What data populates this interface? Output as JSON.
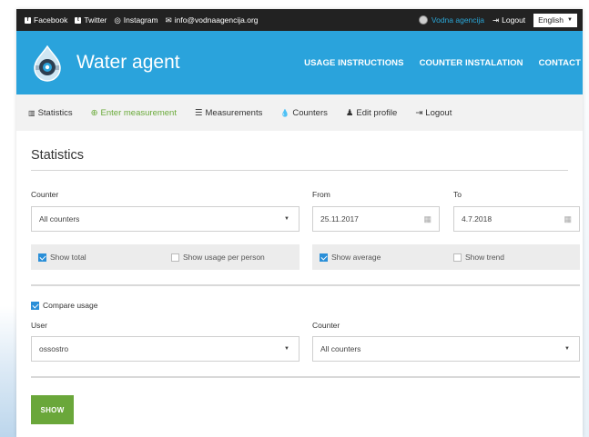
{
  "topbar": {
    "facebook": "Facebook",
    "twitter": "Twitter",
    "instagram": "Instagram",
    "email": "info@vodnaagencija.org",
    "agency": "Vodna agencija",
    "logout": "Logout",
    "language": "English"
  },
  "header": {
    "brand": "Water agent",
    "nav": [
      "USAGE INSTRUCTIONS",
      "COUNTER INSTALATION",
      "CONTACT"
    ]
  },
  "subnav": {
    "statistics": "Statistics",
    "enter": "Enter measurement",
    "measurements": "Measurements",
    "counters": "Counters",
    "edit": "Edit profile",
    "logout": "Logout"
  },
  "page": {
    "title": "Statistics",
    "counter_label": "Counter",
    "counter_value": "All counters",
    "from_label": "From",
    "from_value": "25.11.2017",
    "to_label": "To",
    "to_value": "4.7.2018",
    "show_total": "Show total",
    "show_per_person": "Show usage per person",
    "show_average": "Show average",
    "show_trend": "Show trend",
    "compare": "Compare usage",
    "user_label": "User",
    "user_value": "ossostro",
    "counter2_label": "Counter",
    "counter2_value": "All counters",
    "show_button": "SHOW"
  },
  "colors": {
    "topbar": "#222222",
    "header": "#2aa3dc",
    "accent_green": "#6aa73a",
    "checkbox_blue": "#2a8fd8"
  }
}
